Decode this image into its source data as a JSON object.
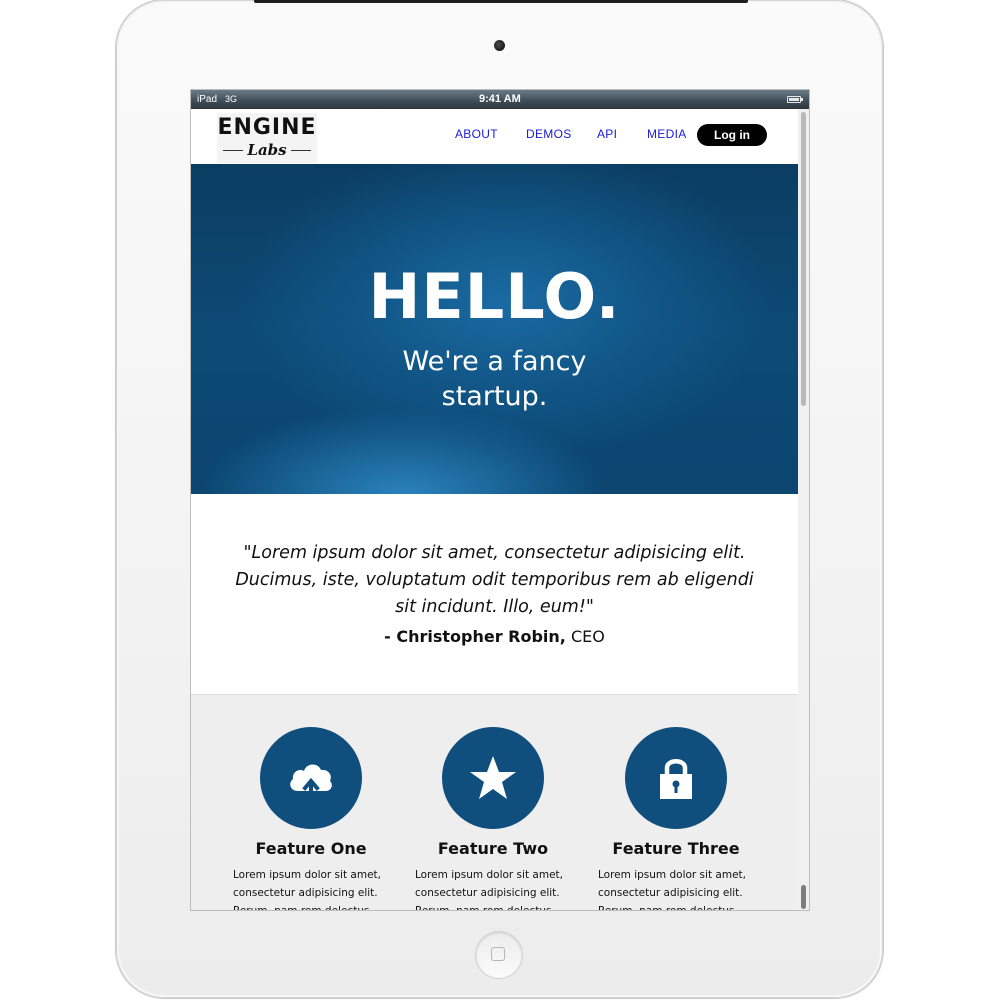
{
  "statusbar": {
    "carrier": "iPad",
    "network": "3G",
    "time": "9:41 AM"
  },
  "logo": {
    "top": "ENGINE",
    "bottom": "Labs"
  },
  "nav": {
    "items": [
      {
        "label": "ABOUT"
      },
      {
        "label": "DEMOS"
      },
      {
        "label": "API"
      },
      {
        "label": "MEDIA"
      }
    ],
    "login_label": "Log in"
  },
  "hero": {
    "title": "HELLO.",
    "subtitle_line1": "We're a fancy",
    "subtitle_line2": "startup."
  },
  "quote": {
    "text": "\"Lorem ipsum dolor sit amet, consectetur adipisicing elit. Ducimus, iste, voluptatum odit temporibus rem ab eligendi sit incidunt. Illo, eum!\"",
    "author": "- Christopher Robin,",
    "role": " CEO"
  },
  "features": [
    {
      "icon": "cloud-upload-icon",
      "title": "Feature One",
      "text": "Lorem ipsum dolor sit amet, consectetur adipisicing elit. Rerum, nam rem delectus"
    },
    {
      "icon": "star-icon",
      "title": "Feature Two",
      "text": "Lorem ipsum dolor sit amet, consectetur adipisicing elit. Rerum, nam rem delectus"
    },
    {
      "icon": "lock-icon",
      "title": "Feature Three",
      "text": "Lorem ipsum dolor sit amet, consectetur adipisicing elit. Rerum, nam rem delectus"
    }
  ],
  "colors": {
    "accent": "#0f4e7d",
    "nav_link": "#1a1adb",
    "login_bg": "#000000",
    "features_bg": "#eeeeee"
  }
}
